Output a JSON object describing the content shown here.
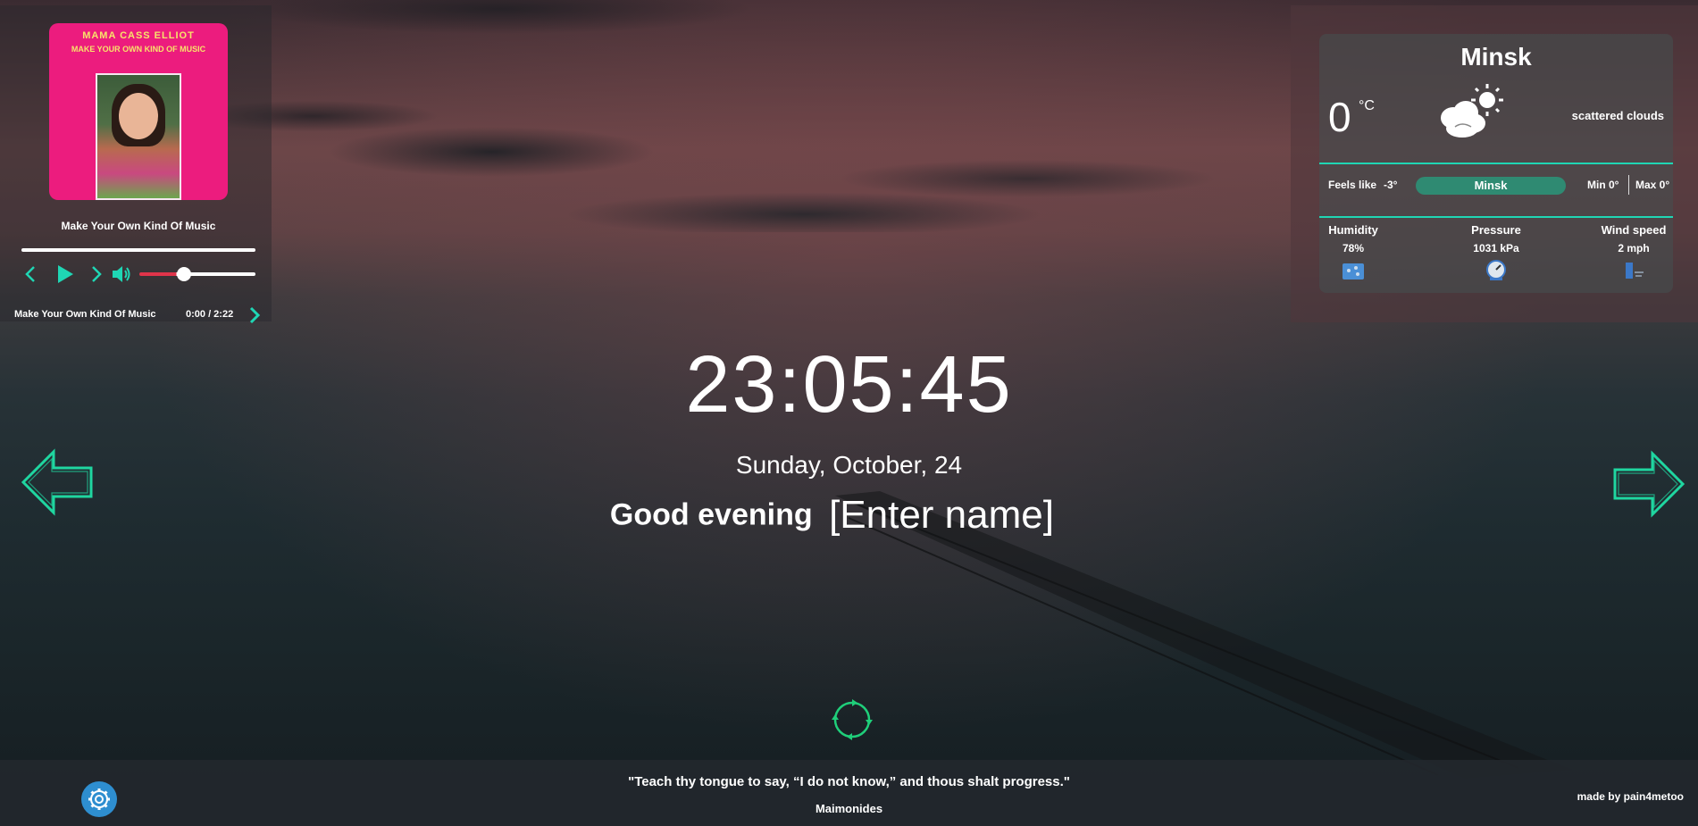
{
  "player": {
    "cover_art": {
      "artist_text": "MAMA CASS ELLIOT",
      "album_text": "MAKE YOUR OWN KIND OF MUSIC"
    },
    "track_title": "Make Your Own Kind Of Music",
    "progress": 0,
    "volume": 0.32,
    "controls": [
      "chevron-left-icon",
      "play-icon",
      "chevron-right-icon",
      "volume-icon"
    ],
    "playlist": [
      {
        "title": "Make Your Own Kind Of Music",
        "time": "0:00 / 2:22"
      }
    ]
  },
  "weather": {
    "city": "Minsk",
    "temp": "0",
    "unit": "°C",
    "icon": "partly-cloudy-icon",
    "description": "scattered clouds",
    "feels_like_label": "Feels like",
    "feels_like": "-3°",
    "city_input": "Minsk",
    "min": "Min  0°",
    "max": "Max  0°",
    "humidity_label": "Humidity",
    "humidity": "78%",
    "pressure_label": "Pressure",
    "pressure": "1031 kPa",
    "wind_label": "Wind speed",
    "wind": "2 mph",
    "accent": "#1fd6b4"
  },
  "main": {
    "time": "23:05:45",
    "date": "Sunday,  October,  24",
    "greeting": "Good evening",
    "name_placeholder": "[Enter name]"
  },
  "footer": {
    "quote": "\"Teach thy tongue to say, “I do not know,” and thous shalt progress.\"",
    "author": "Maimonides",
    "made_by": "made by pain4metoo"
  }
}
